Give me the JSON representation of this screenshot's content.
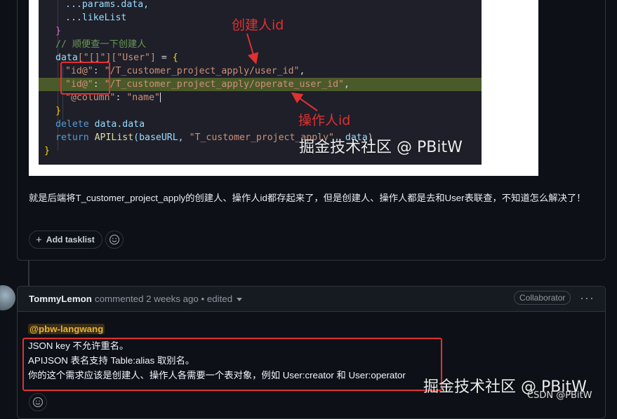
{
  "code_lines": [
    {
      "parts": [
        {
          "t": "...params.data,",
          "c": "tk-prop"
        }
      ]
    },
    {
      "parts": [
        {
          "t": "...likeList",
          "c": "tk-prop"
        }
      ]
    },
    {
      "parts": [
        {
          "t": "}",
          "c": "tk-br2"
        }
      ]
    },
    {
      "parts": [
        {
          "t": "// 顺便查一下创建人",
          "c": "tk-cm"
        }
      ]
    },
    {
      "parts": [
        {
          "t": "data",
          "c": "tk-prop"
        },
        {
          "t": "[\"[]\"][\"User\"]",
          "c": "tk-str"
        },
        {
          "t": " = ",
          "c": "tk-punc"
        },
        {
          "t": "{",
          "c": "tk-brace"
        }
      ]
    },
    {
      "parts": [
        {
          "t": "\"id@\"",
          "c": "tk-str"
        },
        {
          "t": ": ",
          "c": "tk-punc"
        },
        {
          "t": "\"/T_customer_project_apply/user_id\"",
          "c": "tk-str"
        },
        {
          "t": ",",
          "c": "tk-punc"
        }
      ]
    },
    {
      "parts": [
        {
          "t": "\"id@\"",
          "c": "tk-str"
        },
        {
          "t": ": ",
          "c": "tk-punc"
        },
        {
          "t": "\"/T_customer_project_apply/operate_user_id\"",
          "c": "tk-str"
        },
        {
          "t": ",",
          "c": "tk-punc"
        }
      ]
    },
    {
      "parts": [
        {
          "t": "\"@column\"",
          "c": "tk-str"
        },
        {
          "t": ": ",
          "c": "tk-punc"
        },
        {
          "t": "\"name\"",
          "c": "tk-str"
        }
      ]
    },
    {
      "parts": [
        {
          "t": "}",
          "c": "tk-brace"
        }
      ]
    },
    {
      "parts": [
        {
          "t": "delete ",
          "c": "tk-kw"
        },
        {
          "t": "data.data",
          "c": "tk-prop"
        }
      ]
    },
    {
      "parts": [
        {
          "t": "return ",
          "c": "tk-kw"
        },
        {
          "t": "APIList",
          "c": "tk-fn"
        },
        {
          "t": "(baseURL, ",
          "c": "tk-prop"
        },
        {
          "t": "\"T_customer_project_apply\"",
          "c": "tk-str"
        },
        {
          "t": ", ",
          "c": "tk-punc"
        },
        {
          "t": "data",
          "c": "tk-prop"
        },
        {
          "t": ")",
          "c": "tk-punc"
        }
      ]
    },
    {
      "parts": [
        {
          "t": "}",
          "c": "tk-brace"
        }
      ]
    }
  ],
  "annotations": {
    "creator_id": "创建人id",
    "operator_id": "操作人id"
  },
  "watermark": "掘金技术社区 @ PBitW",
  "comment1": {
    "body": "就是后端将T_customer_project_apply的创建人、操作人id都存起来了，但是创建人、操作人都是去和User表联查，不知道怎么解决了！",
    "add_tasklist_label": "Add tasklist"
  },
  "comment2": {
    "author": "TommyLemon",
    "meta": "commented 2 weeks ago • edited",
    "role_badge": "Collaborator",
    "mention": "@pbw-langwang",
    "lines": [
      "JSON key 不允许重名。",
      "APIJSON 表名支持 Table:alias 取别名。",
      "你的这个需求应该是创建人、操作人各需要一个表对象，例如 User:creator 和 User:operator"
    ]
  },
  "csdn_watermark": "CSDN @PBitW",
  "colors": {
    "background": "#0d1117",
    "border": "#30363d",
    "annotation_red": "#e03131",
    "mention": "#e3b341"
  }
}
